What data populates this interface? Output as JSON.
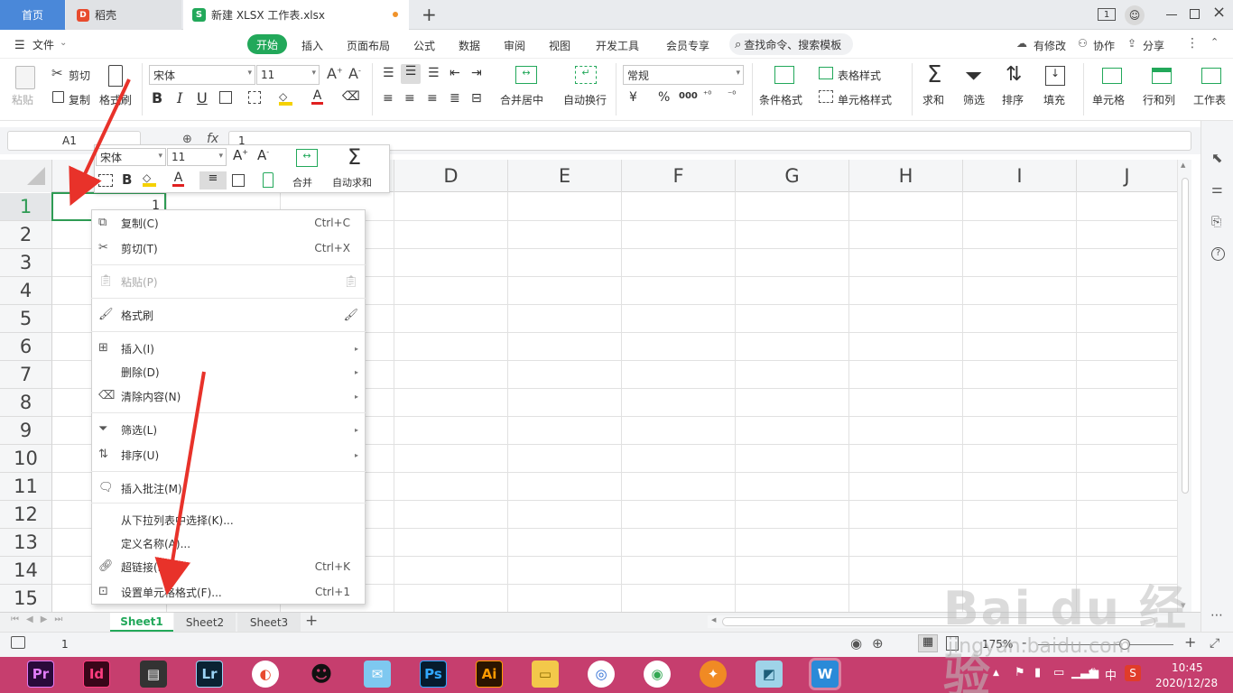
{
  "titlebar": {
    "tabs": [
      {
        "label": "首页"
      },
      {
        "label": "稻壳"
      },
      {
        "label": "新建 XLSX 工作表.xlsx"
      }
    ],
    "new_tab": "+",
    "badge": "1"
  },
  "menubar": {
    "file": "文件",
    "items": [
      "开始",
      "插入",
      "页面布局",
      "公式",
      "数据",
      "审阅",
      "视图",
      "开发工具",
      "会员专享"
    ],
    "search": "查找命令、搜索模板",
    "right": [
      "有修改",
      "协作",
      "分享"
    ]
  },
  "ribbon": {
    "paste": "粘贴",
    "cut": "剪切",
    "copy": "复制",
    "format_painter": "格式刷",
    "font": "宋体",
    "size": "11",
    "merge": "合并居中",
    "wrap": "自动换行",
    "numfmt": "常规",
    "cond": "条件格式",
    "table_style": "表格样式",
    "cell_style": "单元格样式",
    "sum": "求和",
    "filter": "筛选",
    "sort": "排序",
    "fill": "填充",
    "cell": "单元格",
    "rowcol": "行和列",
    "sheet": "工作表",
    "currency": "¥",
    "percent": "%",
    "thousands": "000"
  },
  "formula_bar": {
    "name_box": "A1",
    "fx": "fx",
    "value": "1"
  },
  "grid": {
    "columns": [
      "D",
      "E",
      "F",
      "G",
      "H",
      "I",
      "J"
    ],
    "rows": [
      "1",
      "2",
      "3",
      "4",
      "5",
      "6",
      "7",
      "8",
      "9",
      "10",
      "11",
      "12",
      "13",
      "14",
      "15"
    ],
    "a1_value": "1"
  },
  "mini_toolbar": {
    "font": "宋体",
    "size": "11",
    "merge": "合并",
    "autosum": "自动求和"
  },
  "context_menu": {
    "items": [
      {
        "label": "复制(C)",
        "shortcut": "Ctrl+C"
      },
      {
        "label": "剪切(T)",
        "shortcut": "Ctrl+X"
      },
      {
        "label": "粘贴(P)",
        "shortcut": ""
      },
      {
        "label": "格式刷",
        "shortcut": ""
      },
      {
        "label": "插入(I)",
        "shortcut": ""
      },
      {
        "label": "删除(D)",
        "shortcut": ""
      },
      {
        "label": "清除内容(N)",
        "shortcut": ""
      },
      {
        "label": "筛选(L)",
        "shortcut": ""
      },
      {
        "label": "排序(U)",
        "shortcut": ""
      },
      {
        "label": "插入批注(M)",
        "shortcut": ""
      },
      {
        "label": "从下拉列表中选择(K)...",
        "shortcut": ""
      },
      {
        "label": "定义名称(A)...",
        "shortcut": ""
      },
      {
        "label": "超链接(H)...",
        "shortcut": "Ctrl+K"
      },
      {
        "label": "设置单元格格式(F)...",
        "shortcut": "Ctrl+1"
      }
    ]
  },
  "sheets": [
    "Sheet1",
    "Sheet2",
    "Sheet3"
  ],
  "add_sheet": "+",
  "statusbar": {
    "value": "1",
    "zoom": "175%",
    "zoom_minus": "-",
    "zoom_plus": "+"
  },
  "taskbar": {
    "apps": [
      "Pr",
      "Id",
      "Lr",
      "Ps",
      "Ai"
    ],
    "ime": "中",
    "time": "10:45",
    "date": "2020/12/28"
  },
  "watermark": {
    "text": "Bai du 经验",
    "url": "jingyan.baidu.com"
  },
  "colors": {
    "accent_green": "#22a85a",
    "tab_blue": "#4a88d9",
    "taskbar": "#c63e6e",
    "arrow_red": "#e8322a"
  }
}
